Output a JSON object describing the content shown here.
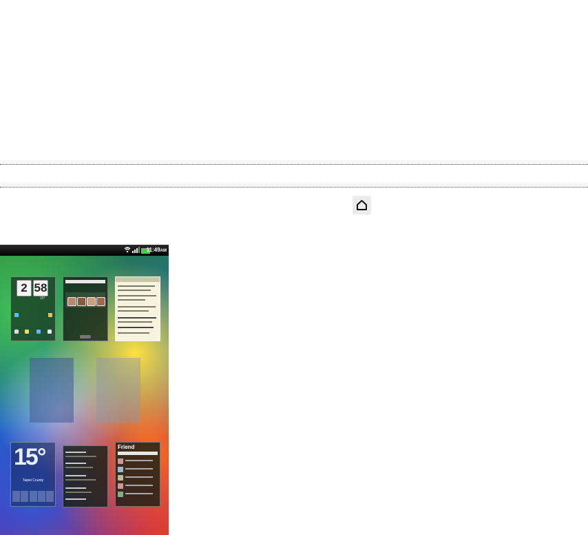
{
  "icons": {
    "home": "home-icon",
    "wifi": "wifi-icon",
    "signal": "signal-bars-icon",
    "battery": "battery-icon"
  },
  "phone": {
    "status_time": "11:49",
    "status_ampm": "AM",
    "thumbnails": {
      "clock_hours": "2",
      "clock_minutes": "58",
      "weather_temp": "15°",
      "weather_city": "Taipei County",
      "friend_title": "Friend"
    }
  },
  "colors": {
    "battery": "#3fd23f",
    "dotted_rule": "#444444"
  }
}
